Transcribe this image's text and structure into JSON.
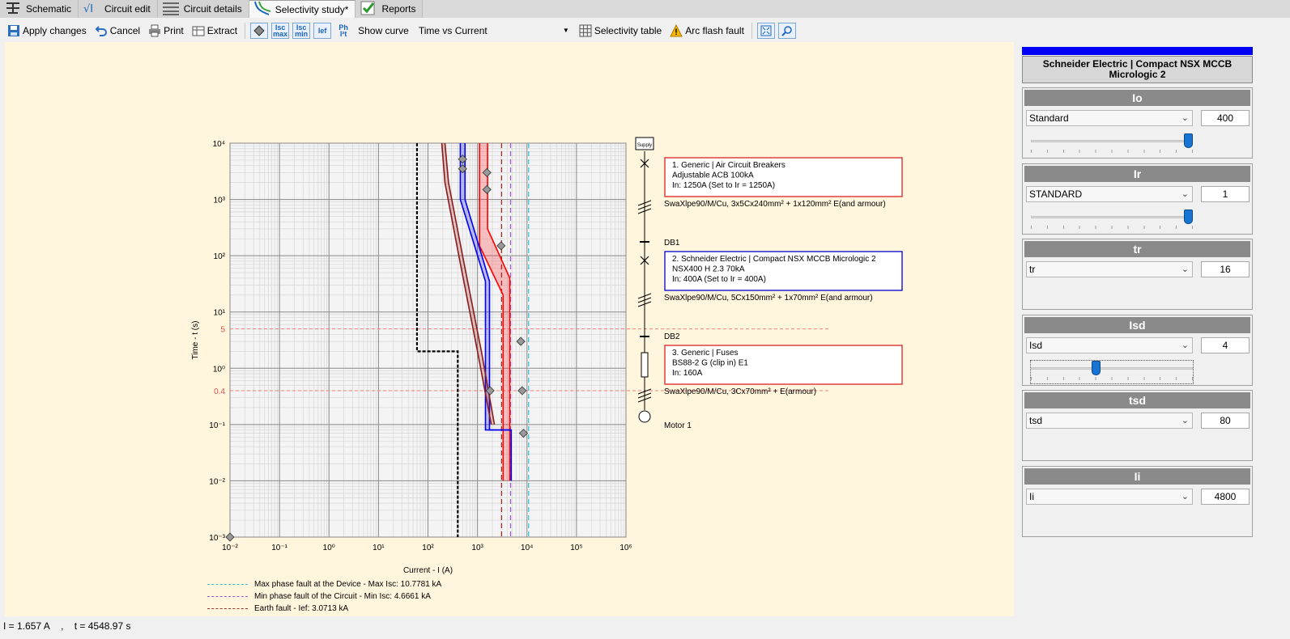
{
  "tabs": [
    {
      "label": "Schematic",
      "icon": "schematic-icon",
      "active": false
    },
    {
      "label": "Circuit edit",
      "icon": "circuit-edit-icon",
      "active": false
    },
    {
      "label": "Circuit details",
      "icon": "circuit-details-icon",
      "active": false
    },
    {
      "label": "Selectivity study*",
      "icon": "selectivity-icon",
      "active": true
    },
    {
      "label": "Reports",
      "icon": "reports-icon",
      "active": false
    }
  ],
  "toolbar": {
    "apply_label": "Apply changes",
    "cancel_label": "Cancel",
    "print_label": "Print",
    "extract_label": "Extract",
    "isc_max_label": "Isc max",
    "isc_min_label": "Isc min",
    "ief_label": "Ief",
    "pt_label": "Ph I²t",
    "show_curve_label": "Show curve",
    "curve_select": "Time vs Current",
    "selectivity_table_label": "Selectivity table",
    "arc_flash_label": "Arc flash fault"
  },
  "chart_data": {
    "type": "line",
    "xlabel": "Current - I (A)",
    "ylabel": "Time - t (s)",
    "x_scale": "log",
    "y_scale": "log",
    "xlim": [
      0.01,
      1000000
    ],
    "ylim": [
      0.001,
      10000
    ],
    "x_tick_labels": [
      "10⁻²",
      "10⁻¹",
      "10⁰",
      "10¹",
      "10²",
      "10³",
      "10⁴",
      "10⁵",
      "10⁶"
    ],
    "y_tick_labels": [
      "10⁴",
      "10³",
      "10²",
      "10¹",
      "10⁰",
      "10⁻¹",
      "10⁻²",
      "10⁻³"
    ],
    "grid": true,
    "time_markers": [
      {
        "label": "5",
        "t": 5
      },
      {
        "label": "0.4",
        "t": 0.4
      }
    ],
    "series": [
      {
        "name": "Air Circuit Breakers (1)",
        "color": "#ff0000",
        "band": true,
        "upper": [
          [
            1600,
            10000
          ],
          [
            1600,
            300
          ],
          [
            4500,
            40
          ],
          [
            4500,
            0.01
          ]
        ],
        "lower": [
          [
            1100,
            10000
          ],
          [
            1100,
            150
          ],
          [
            3300,
            20
          ],
          [
            3300,
            0.01
          ]
        ]
      },
      {
        "name": "Compact NSX MCCB (2)",
        "color": "#0000ee",
        "band": true,
        "upper": [
          [
            560,
            10000
          ],
          [
            560,
            1000
          ],
          [
            1750,
            35
          ],
          [
            1750,
            0.08
          ],
          [
            4800,
            0.08
          ],
          [
            4800,
            0.01
          ]
        ],
        "lower": [
          [
            450,
            10000
          ],
          [
            450,
            1000
          ],
          [
            1450,
            35
          ],
          [
            1450,
            0.08
          ],
          [
            4800,
            0.08
          ]
        ]
      },
      {
        "name": "Fuse (3)",
        "color": "#8b1a1a",
        "band": true,
        "upper": [
          [
            220,
            10000
          ],
          [
            260,
            2000
          ],
          [
            500,
            100
          ],
          [
            1200,
            2
          ],
          [
            2200,
            0.1
          ]
        ],
        "lower": [
          [
            190,
            10000
          ],
          [
            220,
            2000
          ],
          [
            420,
            100
          ],
          [
            1000,
            2
          ],
          [
            1900,
            0.1
          ]
        ]
      },
      {
        "name": "Motor 1",
        "color": "#000000",
        "dashed": true,
        "points": [
          [
            60,
            10000
          ],
          [
            60,
            2
          ],
          [
            400,
            2
          ],
          [
            400,
            0.001
          ]
        ]
      }
    ],
    "fault_lines": [
      {
        "name": "Max phase fault at the Device - Max Isc: 10.7781 kA",
        "color": "#3fbfe0",
        "current": 10778
      },
      {
        "name": "Min phase fault of the Circuit - Min Isc: 4.6661 kA",
        "color": "#a05ad8",
        "current": 4666
      },
      {
        "name": "Earth fault - Ief: 3.0713 kA",
        "color": "#a0302a",
        "current": 3071
      }
    ],
    "markers": [
      {
        "i": 500,
        "t": 5200
      },
      {
        "i": 500,
        "t": 3500
      },
      {
        "i": 1550,
        "t": 3000
      },
      {
        "i": 1550,
        "t": 1500
      },
      {
        "i": 3000,
        "t": 150
      },
      {
        "i": 7500,
        "t": 3
      },
      {
        "i": 1800,
        "t": 0.4
      },
      {
        "i": 8000,
        "t": 0.4
      },
      {
        "i": 8500,
        "t": 0.07
      },
      {
        "i": 0.01,
        "t": 0.001
      }
    ]
  },
  "diagram": {
    "supply_label": "Supply",
    "devices": [
      {
        "lines": [
          "1. Generic | Air Circuit Breakers",
          "Adjustable ACB 100kA",
          "In: 1250A (Set to Ir = 1250A)"
        ],
        "border": "#e02020"
      },
      {
        "lines": [
          "2. Schneider Electric | Compact NSX MCCB Micrologic 2",
          "NSX400 H 2.3 70kA",
          "In: 400A (Set to Ir = 400A)"
        ],
        "border": "#0000cc"
      },
      {
        "lines": [
          "3. Generic | Fuses",
          "BS88-2 G (clip in) E1",
          "In: 160A"
        ],
        "border": "#e02020"
      }
    ],
    "cables": [
      "SwaXlpe90/M/Cu, 3x5Cx240mm² + 1x120mm² E(and armour)",
      "SwaXlpe90/M/Cu, 5Cx150mm² + 1x70mm² E(and armour)",
      "SwaXlpe90/M/Cu, 3Cx70mm² + E(armour)"
    ],
    "boards": [
      "DB1",
      "DB2"
    ],
    "load_label": "Motor 1"
  },
  "panel": {
    "device_title": "Schneider Electric | Compact NSX MCCB Micrologic 2",
    "accent": "#0000f5",
    "params": [
      {
        "title": "Io",
        "select": "Standard",
        "value": "400",
        "slider": 0.97,
        "has_slider": true
      },
      {
        "title": "Ir",
        "select": "STANDARD",
        "value": "1",
        "slider": 0.97,
        "has_slider": true
      },
      {
        "title": "tr",
        "select": "tr",
        "value": "16",
        "has_slider": false
      },
      {
        "title": "Isd",
        "select": "Isd",
        "value": "4",
        "slider": 0.4,
        "has_slider": true,
        "focused": true
      },
      {
        "title": "tsd",
        "select": "tsd",
        "value": "80",
        "has_slider": false
      },
      {
        "title": "Ii",
        "select": "Ii",
        "value": "4800",
        "has_slider": false
      }
    ]
  },
  "status": {
    "current": "I = 1.657 A",
    "separator": ",",
    "time": "t = 4548.97 s"
  }
}
